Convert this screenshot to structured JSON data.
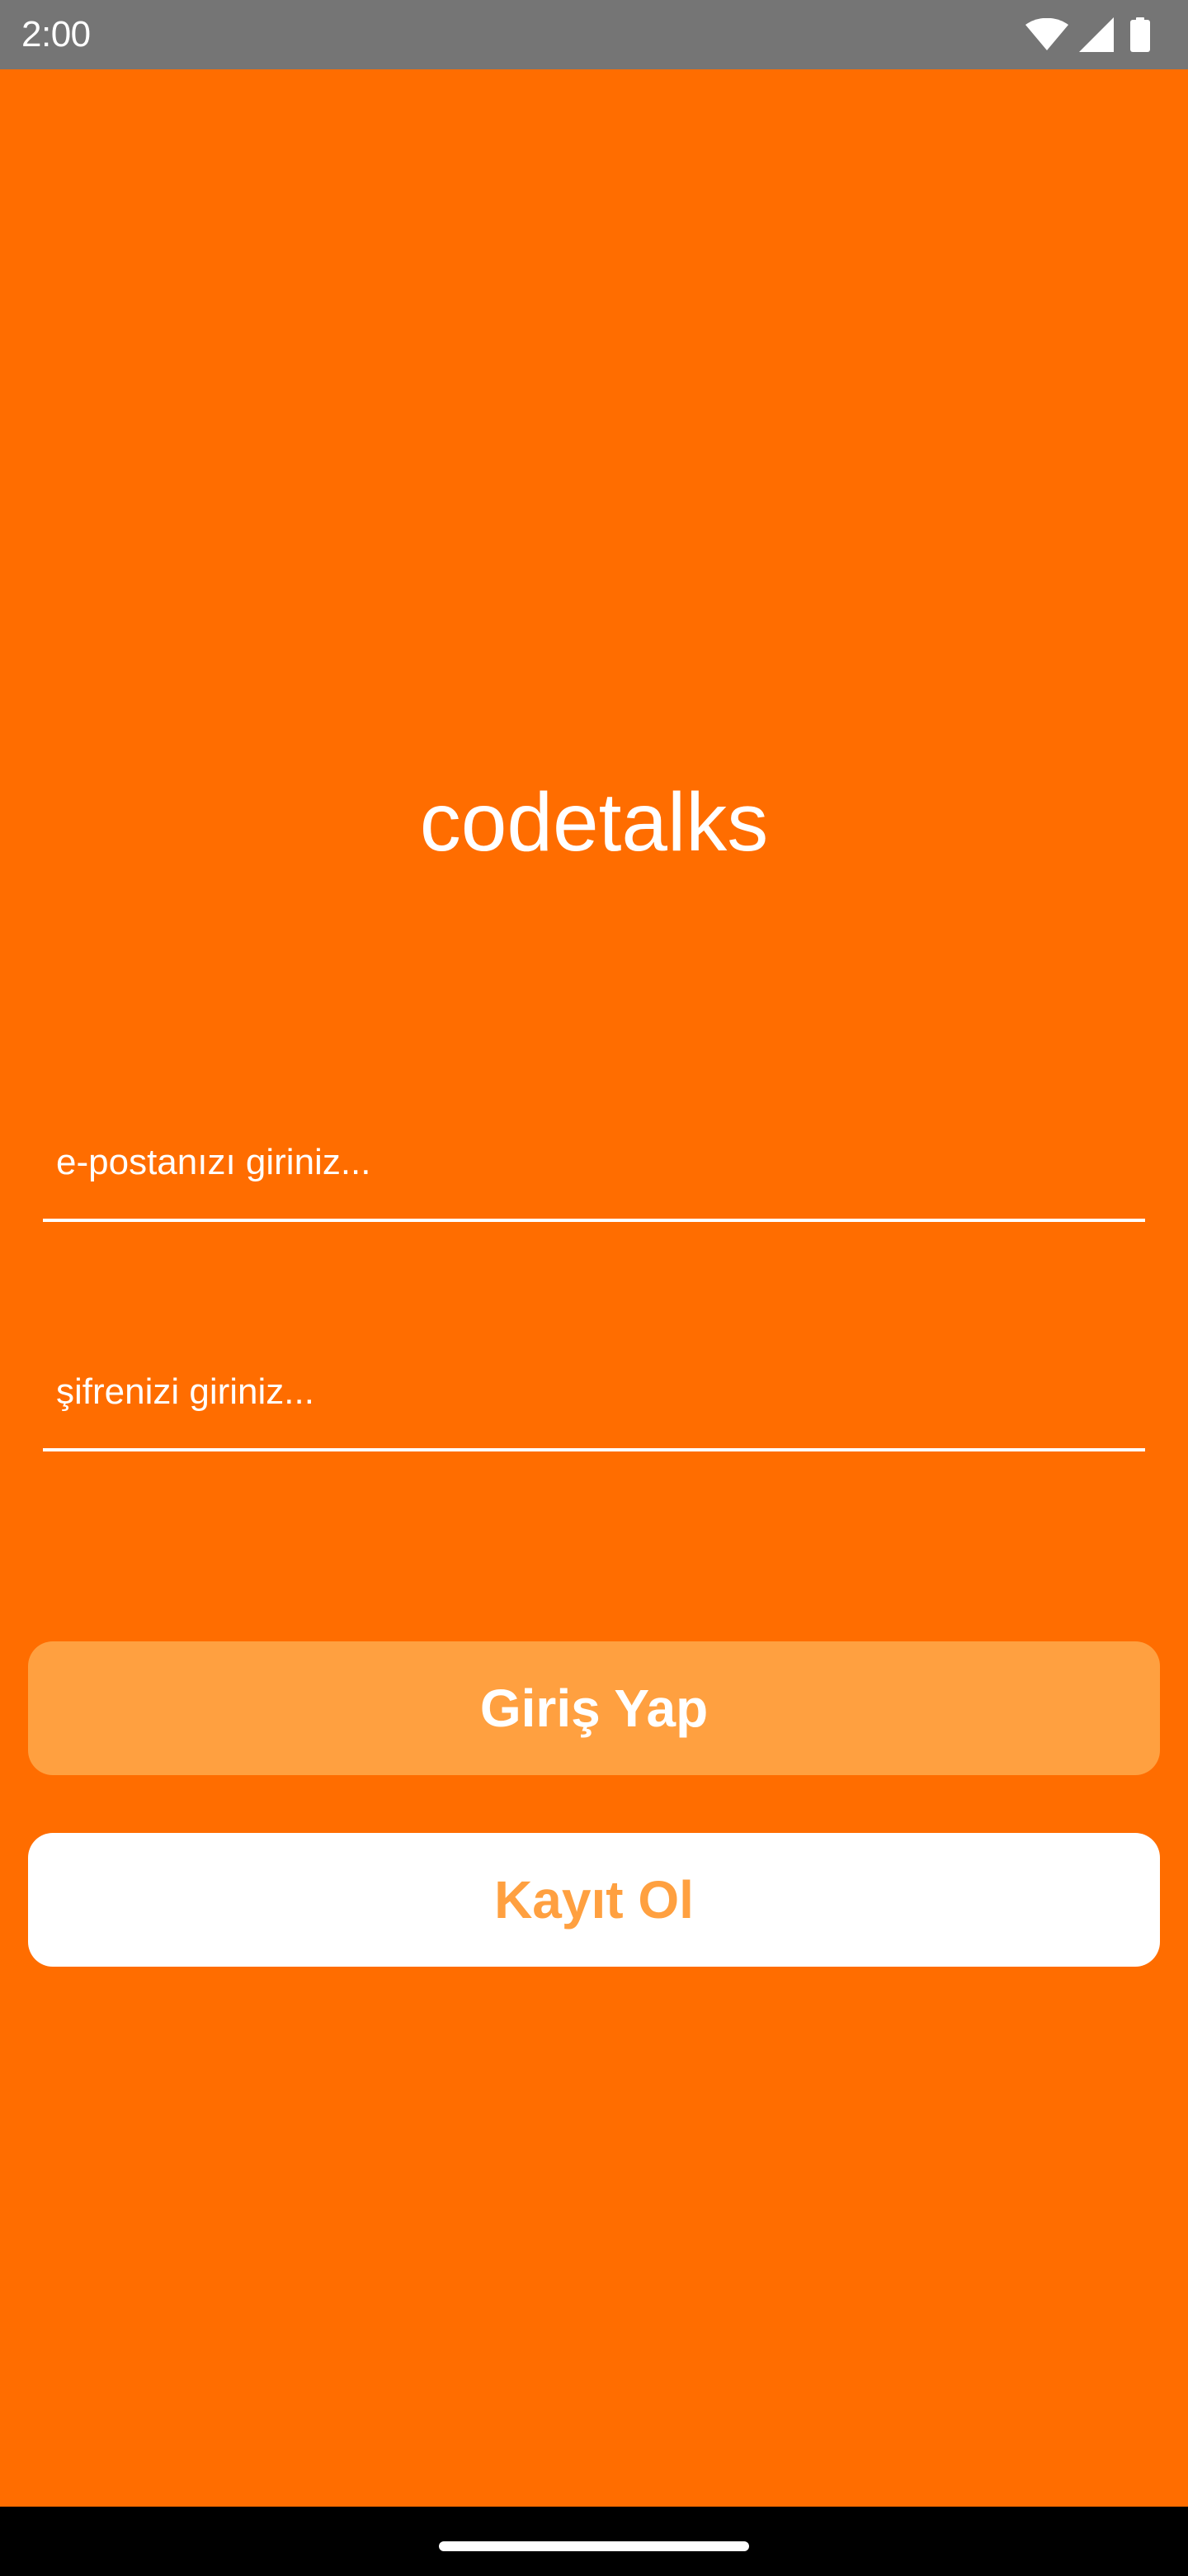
{
  "status_bar": {
    "time": "2:00",
    "icons": [
      "wifi-icon",
      "signal-icon",
      "battery-icon"
    ],
    "background": "#757575"
  },
  "app": {
    "title": "codetalks",
    "background": "#FF6D00"
  },
  "form": {
    "email": {
      "value": "",
      "placeholder": "e-postanızı giriniz..."
    },
    "password": {
      "value": "",
      "placeholder": "şifrenizi giriniz..."
    }
  },
  "buttons": {
    "login": {
      "label": "Giriş Yap",
      "background": "#FFA040",
      "text_color": "#FFFFFF"
    },
    "register": {
      "label": "Kayıt Ol",
      "background": "#FFFFFF",
      "text_color": "#FFA040"
    }
  },
  "nav_bar": {
    "background": "#000000"
  }
}
